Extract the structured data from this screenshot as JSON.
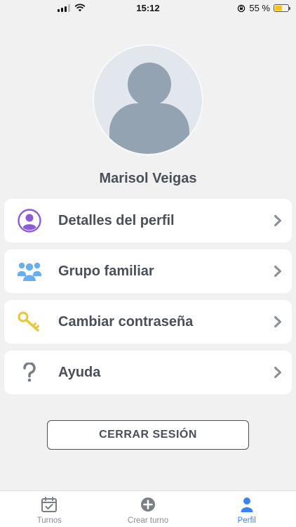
{
  "status_bar": {
    "time": "15:12",
    "battery": "55 %",
    "battery_level": 0.55
  },
  "profile": {
    "name": "Marisol Veigas"
  },
  "menu": {
    "items": [
      {
        "label": "Detalles del perfil",
        "icon": "user-circle-icon",
        "color": "#8e5bd6"
      },
      {
        "label": "Grupo familiar",
        "icon": "group-icon",
        "color": "#6aaef0"
      },
      {
        "label": "Cambiar contraseña",
        "icon": "key-icon",
        "color": "#e8c53a"
      },
      {
        "label": "Ayuda",
        "icon": "question-icon",
        "color": "#7a7f86"
      }
    ]
  },
  "logout": {
    "label": "CERRAR SESIÓN"
  },
  "tabs": [
    {
      "label": "Turnos",
      "icon": "calendar-check-icon",
      "active": false
    },
    {
      "label": "Crear turno",
      "icon": "plus-circle-icon",
      "active": false
    },
    {
      "label": "Perfil",
      "icon": "person-icon",
      "active": true
    }
  ],
  "colors": {
    "accent": "#3b82f6",
    "text": "#4a4f5a",
    "background": "#f1f1f1"
  }
}
